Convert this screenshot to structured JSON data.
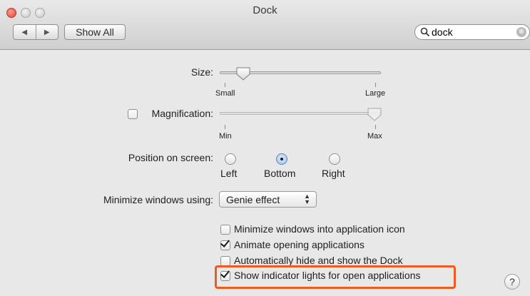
{
  "window": {
    "title": "Dock"
  },
  "toolbar": {
    "back_icon": "◀",
    "forward_icon": "▶",
    "show_all_label": "Show All",
    "search_value": "dock",
    "search_icon": "magnifier-icon",
    "clear_icon": "⊗"
  },
  "size": {
    "label": "Size:",
    "min_label": "Small",
    "max_label": "Large",
    "value_fraction": 0.15
  },
  "magnification": {
    "label": "Magnification:",
    "checked": false,
    "min_label": "Min",
    "max_label": "Max",
    "value_fraction": 1.0
  },
  "position": {
    "label": "Position on screen:",
    "options": [
      "Left",
      "Bottom",
      "Right"
    ],
    "selected": "Bottom"
  },
  "minimize": {
    "label": "Minimize windows using:",
    "value": "Genie effect"
  },
  "checkboxes": [
    {
      "label": "Minimize windows into application icon",
      "checked": false
    },
    {
      "label": "Animate opening applications",
      "checked": true
    },
    {
      "label": "Automatically hide and show the Dock",
      "checked": false
    },
    {
      "label": "Show indicator lights for open applications",
      "checked": true
    }
  ],
  "help": {
    "label": "?"
  },
  "colors": {
    "highlight": "#ee5a21",
    "accent": "#5d86c3"
  }
}
